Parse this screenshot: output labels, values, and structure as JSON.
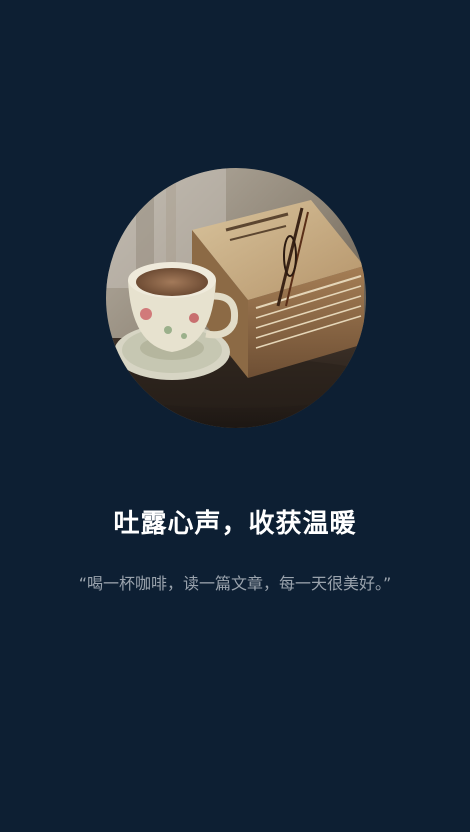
{
  "splash": {
    "hero_image": "coffee-cup-and-old-book",
    "headline": "吐露心声，收获温暖",
    "quote": "“喝一杯咖啡，读一篇文章，每一天很美好。”"
  },
  "colors": {
    "background": "#0d1f33",
    "headline": "#ffffff",
    "quote": "#9aa3ad"
  }
}
